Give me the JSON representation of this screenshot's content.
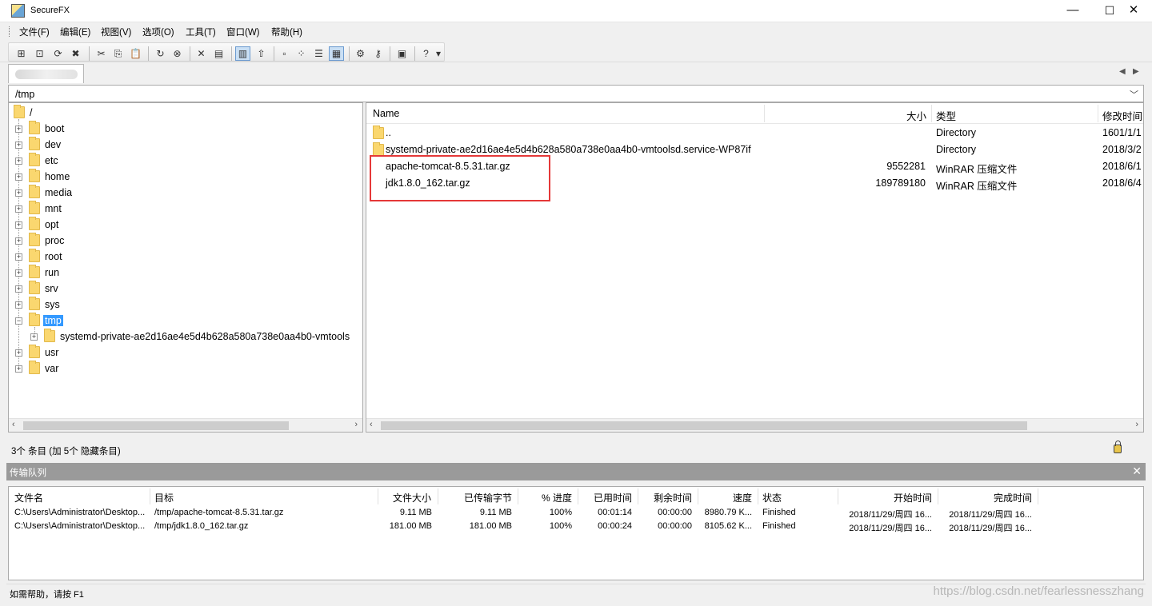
{
  "window": {
    "title": "SecureFX"
  },
  "menu": [
    "文件(F)",
    "编辑(E)",
    "视图(V)",
    "选项(O)",
    "工具(T)",
    "窗口(W)",
    "帮助(H)"
  ],
  "path": "/tmp",
  "tree": {
    "root": "/",
    "items": [
      "boot",
      "dev",
      "etc",
      "home",
      "media",
      "mnt",
      "opt",
      "proc",
      "root",
      "run",
      "srv",
      "sys",
      "tmp",
      "usr",
      "var"
    ],
    "selected": "tmp",
    "child": "systemd-private-ae2d16ae4e5d4b628a580a738e0aa4b0-vmtools"
  },
  "filelist": {
    "headers": {
      "name": "Name",
      "size": "大小",
      "type": "类型",
      "modified": "修改时间"
    },
    "rows": [
      {
        "name": "..",
        "size": "",
        "type": "Directory",
        "modified": "1601/1/1"
      },
      {
        "name": "systemd-private-ae2d16ae4e5d4b628a580a738e0aa4b0-vmtoolsd.service-WP87if",
        "size": "",
        "type": "Directory",
        "modified": "2018/3/2"
      },
      {
        "name": "apache-tomcat-8.5.31.tar.gz",
        "size": "9552281",
        "type": "WinRAR 压缩文件",
        "modified": "2018/6/1"
      },
      {
        "name": "jdk1.8.0_162.tar.gz",
        "size": "189789180",
        "type": "WinRAR 压缩文件",
        "modified": "2018/6/4"
      }
    ]
  },
  "status": {
    "items_text": "3个 条目 (加 5个 隐藏条目)"
  },
  "queue": {
    "title": "传输队列",
    "headers": {
      "filename": "文件名",
      "target": "目标",
      "filesize": "文件大小",
      "transferred": "已传输字节",
      "percent": "% 进度",
      "elapsed": "已用时间",
      "remaining": "剩余时间",
      "speed": "速度",
      "state": "状态",
      "start": "开始时间",
      "finish": "完成时间"
    },
    "rows": [
      {
        "filename": "C:\\Users\\Administrator\\Desktop...",
        "target": "/tmp/apache-tomcat-8.5.31.tar.gz",
        "filesize": "9.11 MB",
        "transferred": "9.11 MB",
        "percent": "100%",
        "elapsed": "00:01:14",
        "remaining": "00:00:00",
        "speed": "8980.79 K...",
        "state": "Finished",
        "start": "2018/11/29/周四 16...",
        "finish": "2018/11/29/周四 16..."
      },
      {
        "filename": "C:\\Users\\Administrator\\Desktop...",
        "target": "/tmp/jdk1.8.0_162.tar.gz",
        "filesize": "181.00 MB",
        "transferred": "181.00 MB",
        "percent": "100%",
        "elapsed": "00:00:24",
        "remaining": "00:00:00",
        "speed": "8105.62 K...",
        "state": "Finished",
        "start": "2018/11/29/周四 16...",
        "finish": "2018/11/29/周四 16..."
      }
    ]
  },
  "bottom_status": "如需帮助，请按 F1",
  "watermark": "https://blog.csdn.net/fearlessnesszhang",
  "colors": {
    "selection": "#3399ff",
    "highlight_box": "#e53838",
    "queue_header": "#9a9a9a"
  }
}
